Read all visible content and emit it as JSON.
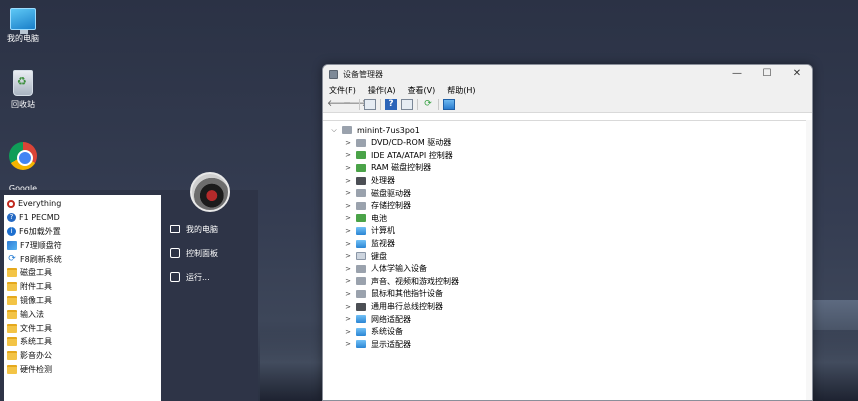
{
  "desktop": {
    "icons": [
      {
        "label": "我的电脑",
        "icon": "computer-icon"
      },
      {
        "label": "回收站",
        "icon": "recycle-bin-icon"
      },
      {
        "label": "Google\nChrome",
        "icon": "chrome-icon"
      }
    ]
  },
  "start_menu": {
    "programs": [
      {
        "label": "Everything",
        "icon": "search-icon"
      },
      {
        "label": "F1 PECMD",
        "icon": "help-icon"
      },
      {
        "label": "F6加载外置",
        "icon": "info-icon"
      },
      {
        "label": "F7理顺盘符",
        "icon": "drive-icon"
      },
      {
        "label": "F8刷新系统",
        "icon": "refresh-icon"
      },
      {
        "label": "磁盘工具",
        "icon": "folder-icon"
      },
      {
        "label": "附件工具",
        "icon": "folder-icon"
      },
      {
        "label": "镜像工具",
        "icon": "folder-icon"
      },
      {
        "label": "输入法",
        "icon": "folder-icon"
      },
      {
        "label": "文件工具",
        "icon": "folder-icon"
      },
      {
        "label": "系统工具",
        "icon": "folder-icon"
      },
      {
        "label": "影音办公",
        "icon": "folder-icon"
      },
      {
        "label": "硬件检测",
        "icon": "folder-icon"
      }
    ],
    "right_items": [
      {
        "label": "我的电脑",
        "icon": "computer-icon"
      },
      {
        "label": "控制面板",
        "icon": "control-panel-icon"
      },
      {
        "label": "运行...",
        "icon": "run-icon"
      }
    ]
  },
  "device_manager": {
    "title": "设备管理器",
    "window_buttons": {
      "minimize": "—",
      "maximize": "☐",
      "close": "✕"
    },
    "menu": [
      "文件(F)",
      "操作(A)",
      "查看(V)",
      "帮助(H)"
    ],
    "root": "minint-7us3po1",
    "categories": [
      {
        "label": "DVD/CD-ROM 驱动器",
        "icon": "dvd-icon"
      },
      {
        "label": "IDE ATA/ATAPI 控制器",
        "icon": "ide-controller-icon"
      },
      {
        "label": "RAM 磁盘控制器",
        "icon": "ram-disk-icon"
      },
      {
        "label": "处理器",
        "icon": "processor-icon"
      },
      {
        "label": "磁盘驱动器",
        "icon": "disk-drive-icon"
      },
      {
        "label": "存储控制器",
        "icon": "storage-controller-icon"
      },
      {
        "label": "电池",
        "icon": "battery-icon"
      },
      {
        "label": "计算机",
        "icon": "computer-icon"
      },
      {
        "label": "监视器",
        "icon": "monitor-icon"
      },
      {
        "label": "键盘",
        "icon": "keyboard-icon"
      },
      {
        "label": "人体学输入设备",
        "icon": "hid-icon"
      },
      {
        "label": "声音、视频和游戏控制器",
        "icon": "sound-icon"
      },
      {
        "label": "鼠标和其他指针设备",
        "icon": "mouse-icon"
      },
      {
        "label": "通用串行总线控制器",
        "icon": "usb-icon"
      },
      {
        "label": "网络适配器",
        "icon": "network-adapter-icon"
      },
      {
        "label": "系统设备",
        "icon": "system-devices-icon"
      },
      {
        "label": "显示适配器",
        "icon": "display-adapter-icon"
      }
    ]
  }
}
